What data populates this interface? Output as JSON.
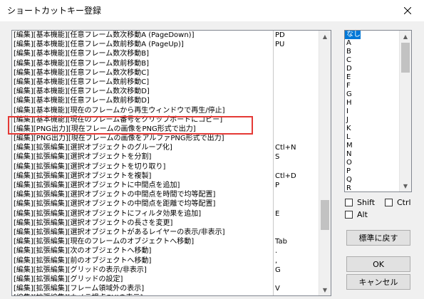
{
  "window": {
    "title": "ショートカットキー登録"
  },
  "commands": [
    {
      "cmd": "[編集][基本機能][任意フレーム数次移動A (PageDown)]",
      "key": "PD"
    },
    {
      "cmd": "[編集][基本機能][任意フレーム数前移動A (PageUp)]",
      "key": "PU"
    },
    {
      "cmd": "[編集][基本機能][任意フレーム数次移動B]",
      "key": ""
    },
    {
      "cmd": "[編集][基本機能][任意フレーム数前移動B]",
      "key": ""
    },
    {
      "cmd": "[編集][基本機能][任意フレーム数次移動C]",
      "key": ""
    },
    {
      "cmd": "[編集][基本機能][任意フレーム数前移動C]",
      "key": ""
    },
    {
      "cmd": "[編集][基本機能][任意フレーム数次移動D]",
      "key": ""
    },
    {
      "cmd": "[編集][基本機能][任意フレーム数前移動D]",
      "key": ""
    },
    {
      "cmd": "[編集][基本機能][現在のフレームから再生ウィンドウで再生/停止]",
      "key": ""
    },
    {
      "cmd": "[編集][基本機能][現在のフレーム番号をクリップボードにコピー]",
      "key": ""
    },
    {
      "cmd": "[編集][PNG出力][現在フレームの画像をPNG形式で出力]",
      "key": ""
    },
    {
      "cmd": "[編集][PNG出力][現在フレームの画像をアルファPNG形式で出力]",
      "key": ""
    },
    {
      "cmd": "[編集][拡張編集][選択オブジェクトのグループ化]",
      "key": "Ctl+N"
    },
    {
      "cmd": "[編集][拡張編集][選択オブジェクトを分割]",
      "key": "S"
    },
    {
      "cmd": "[編集][拡張編集][選択オブジェクトを切り取り]",
      "key": ""
    },
    {
      "cmd": "[編集][拡張編集][選択オブジェクトを複製]",
      "key": "Ctl+D"
    },
    {
      "cmd": "[編集][拡張編集][選択オブジェクトに中間点を追加]",
      "key": "P"
    },
    {
      "cmd": "[編集][拡張編集][選択オブジェクトの中間点を時間で均等配置]",
      "key": ""
    },
    {
      "cmd": "[編集][拡張編集][選択オブジェクトの中間点を距離で均等配置]",
      "key": ""
    },
    {
      "cmd": "[編集][拡張編集][選択オブジェクトにフィルタ効果を追加]",
      "key": "E"
    },
    {
      "cmd": "[編集][拡張編集][選択オブジェクトの長さを変更]",
      "key": ""
    },
    {
      "cmd": "[編集][拡張編集][選択オブジェクトがあるレイヤーの表示/非表示]",
      "key": ""
    },
    {
      "cmd": "[編集][拡張編集][現在のフレームのオブジェクトへ移動]",
      "key": "Tab"
    },
    {
      "cmd": "[編集][拡張編集][次のオブジェクトへ移動]",
      "key": "."
    },
    {
      "cmd": "[編集][拡張編集][前のオブジェクトへ移動]",
      "key": ","
    },
    {
      "cmd": "[編集][拡張編集][グリッドの表示/非表示]",
      "key": "G"
    },
    {
      "cmd": "[編集][拡張編集][グリッドの設定]",
      "key": ""
    },
    {
      "cmd": "[編集][拡張編集][フレーム領域外の表示]",
      "key": "V"
    },
    {
      "cmd": "[編集][拡張編集][カメラ視点GUIの表示]",
      "key": ""
    },
    {
      "cmd": "[編集][拡張編集][画像処理の間引きON/OFF]",
      "key": "Q"
    }
  ],
  "keys": [
    "なし",
    "A",
    "B",
    "C",
    "D",
    "E",
    "F",
    "G",
    "H",
    "I",
    "J",
    "K",
    "L",
    "M",
    "N",
    "O",
    "P",
    "Q",
    "R"
  ],
  "selected_key": "なし",
  "modifiers": {
    "shift": "Shift",
    "ctrl": "Ctrl",
    "alt": "Alt"
  },
  "buttons": {
    "reset": "標準に戻す",
    "ok": "OK",
    "cancel": "キャンセル"
  },
  "colors": {
    "highlight": "#e53935",
    "selection": "#0078d7"
  }
}
